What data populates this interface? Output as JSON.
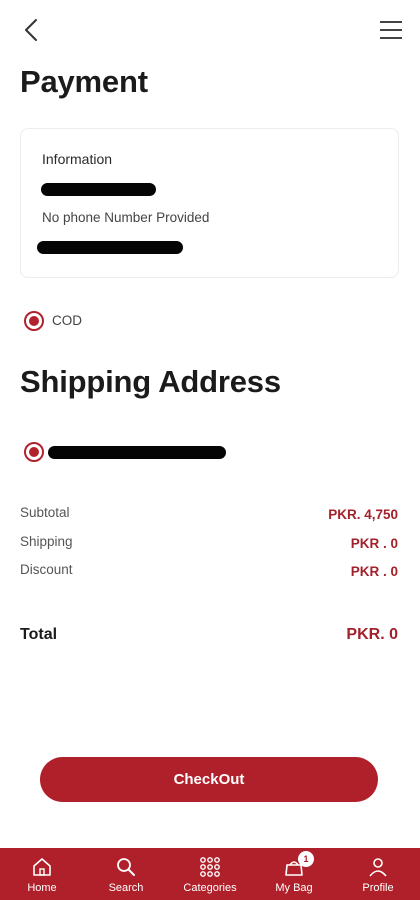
{
  "header": {
    "back_icon": "chevron-left-icon",
    "menu_icon": "hamburger-menu-icon"
  },
  "page_title": "Payment",
  "information": {
    "title": "Information",
    "phone_text": "No phone Number Provided"
  },
  "payment_method": {
    "label": "COD",
    "selected": true
  },
  "shipping": {
    "title": "Shipping Address"
  },
  "summary": [
    {
      "label": "Subtotal",
      "value": "PKR. 4,750"
    },
    {
      "label": "Shipping",
      "value": "PKR . 0"
    },
    {
      "label": "Discount",
      "value": "PKR . 0"
    }
  ],
  "total": {
    "label": "Total",
    "value": "PKR. 0"
  },
  "checkout_label": "CheckOut",
  "nav": [
    {
      "label": "Home",
      "icon": "home-icon"
    },
    {
      "label": "Search",
      "icon": "search-icon"
    },
    {
      "label": "Categories",
      "icon": "grid-icon"
    },
    {
      "label": "My Bag",
      "icon": "bag-icon",
      "badge": "1"
    },
    {
      "label": "Profile",
      "icon": "profile-icon"
    }
  ],
  "colors": {
    "accent": "#b0202a",
    "price": "#a3212b"
  }
}
